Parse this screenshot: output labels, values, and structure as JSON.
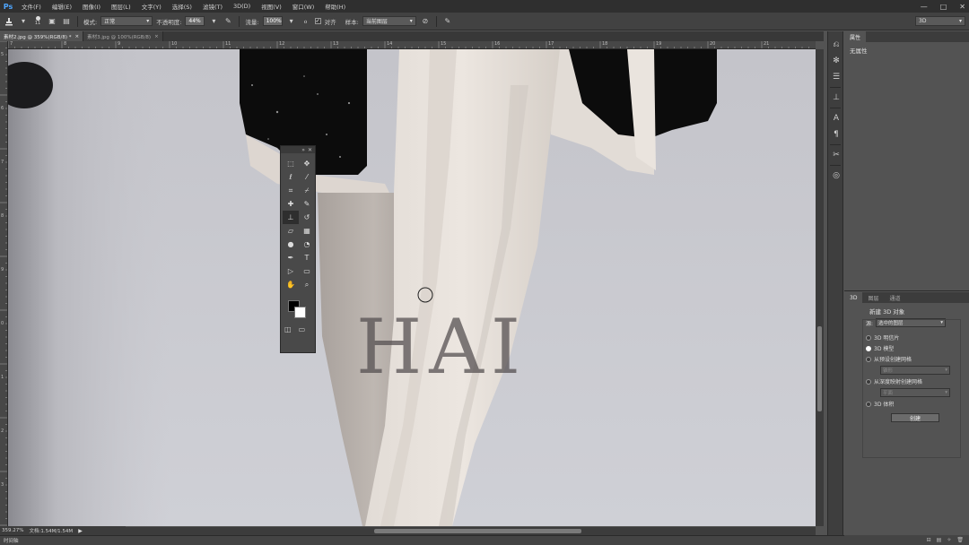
{
  "app": {
    "logo": "Ps"
  },
  "menu": [
    "文件(F)",
    "编辑(E)",
    "图像(I)",
    "图层(L)",
    "文字(Y)",
    "选择(S)",
    "滤镜(T)",
    "3D(D)",
    "视图(V)",
    "窗口(W)",
    "帮助(H)"
  ],
  "window_buttons": [
    "—",
    "□",
    "✕"
  ],
  "options": {
    "brush_size": "11",
    "mode_label": "模式:",
    "mode_value": "正常",
    "opacity_label": "不透明度:",
    "opacity_value": "44%",
    "flow_label": "流量:",
    "flow_value": "100%",
    "aligned_label": "对齐",
    "sample_label": "样本:",
    "sample_value": "当前图层",
    "workspace": "3D"
  },
  "tabs": [
    {
      "label": "素材2.jpg @ 359%(RGB/8) *",
      "close": "×",
      "active": true
    },
    {
      "label": "素材3.jpg @ 100%(RGB/8)",
      "close": "×",
      "active": false
    }
  ],
  "ruler": {
    "h_ticks": [
      "7",
      "8",
      "9",
      "10",
      "11",
      "12",
      "13",
      "14",
      "15",
      "16",
      "17",
      "18",
      "19",
      "20",
      "21"
    ],
    "v_ticks": [
      "5",
      "6",
      "7",
      "8",
      "9",
      "0",
      "1",
      "2",
      "3",
      "4"
    ]
  },
  "canvas": {
    "watermark": "HAI"
  },
  "scrollbars": {
    "v_thumb_start": 0.58,
    "v_thumb_length": 0.18,
    "h_thumb_start": 0.36,
    "h_thumb_length": 0.3
  },
  "status": {
    "zoom": "359.27%",
    "doc": "文档:1.54M/1.54M",
    "arrow": "▶"
  },
  "timeline": "时间轴",
  "properties_panel": {
    "tab": "属性",
    "text": "无属性"
  },
  "panel_3d": {
    "tabs": [
      "3D",
      "图层",
      "通道"
    ],
    "title": "新建 3D 对象",
    "source_label": "源:",
    "source_value": "选中的图层",
    "options": [
      {
        "label": "3D 明信片",
        "selected": false
      },
      {
        "label": "3D 模型",
        "selected": true
      },
      {
        "label": "从预设创建网格",
        "selected": false
      },
      {
        "label": "从深度映射创建网格",
        "selected": false
      },
      {
        "label": "3D 体积",
        "selected": false
      }
    ],
    "preset_value": "锥形",
    "depth_value": "平面",
    "create_button": "创建"
  },
  "colors": {
    "accent": "#4ea6ff",
    "foreground": "#000000",
    "background": "#ffffff"
  }
}
